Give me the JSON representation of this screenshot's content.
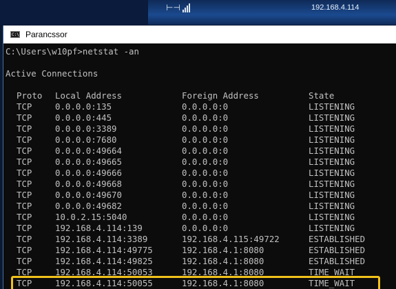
{
  "topbar": {
    "pin_icon": "pin-icon",
    "signal_icon": "signal-bars-icon",
    "ip_text": "192.168.4.114"
  },
  "window": {
    "title": "Parancssor",
    "icon": "cmd-icon"
  },
  "console": {
    "prompt": "C:\\Users\\w10pf>netstat -an",
    "section_title": "Active Connections",
    "headers": [
      "Proto",
      "Local Address",
      "Foreign Address",
      "State"
    ],
    "rows": [
      [
        "TCP",
        "0.0.0.0:135",
        "0.0.0.0:0",
        "LISTENING"
      ],
      [
        "TCP",
        "0.0.0.0:445",
        "0.0.0.0:0",
        "LISTENING"
      ],
      [
        "TCP",
        "0.0.0.0:3389",
        "0.0.0.0:0",
        "LISTENING"
      ],
      [
        "TCP",
        "0.0.0.0:7680",
        "0.0.0.0:0",
        "LISTENING"
      ],
      [
        "TCP",
        "0.0.0.0:49664",
        "0.0.0.0:0",
        "LISTENING"
      ],
      [
        "TCP",
        "0.0.0.0:49665",
        "0.0.0.0:0",
        "LISTENING"
      ],
      [
        "TCP",
        "0.0.0.0:49666",
        "0.0.0.0:0",
        "LISTENING"
      ],
      [
        "TCP",
        "0.0.0.0:49668",
        "0.0.0.0:0",
        "LISTENING"
      ],
      [
        "TCP",
        "0.0.0.0:49670",
        "0.0.0.0:0",
        "LISTENING"
      ],
      [
        "TCP",
        "0.0.0.0:49682",
        "0.0.0.0:0",
        "LISTENING"
      ],
      [
        "TCP",
        "10.0.2.15:5040",
        "0.0.0.0:0",
        "LISTENING"
      ],
      [
        "TCP",
        "192.168.4.114:139",
        "0.0.0.0:0",
        "LISTENING"
      ],
      [
        "TCP",
        "192.168.4.114:3389",
        "192.168.4.115:49722",
        "ESTABLISHED"
      ],
      [
        "TCP",
        "192.168.4.114:49775",
        "192.168.4.1:8080",
        "ESTABLISHED"
      ],
      [
        "TCP",
        "192.168.4.114:49825",
        "192.168.4.1:8080",
        "ESTABLISHED"
      ],
      [
        "TCP",
        "192.168.4.114:50053",
        "192.168.4.1:8080",
        "TIME_WAIT"
      ],
      [
        "TCP",
        "192.168.4.114:50055",
        "192.168.4.1:8080",
        "TIME_WAIT"
      ]
    ],
    "highlighted_row": 12,
    "highlight_color": "#f2c21b",
    "text_color": "#c0c0c0",
    "background_color": "#0c0c0c"
  }
}
